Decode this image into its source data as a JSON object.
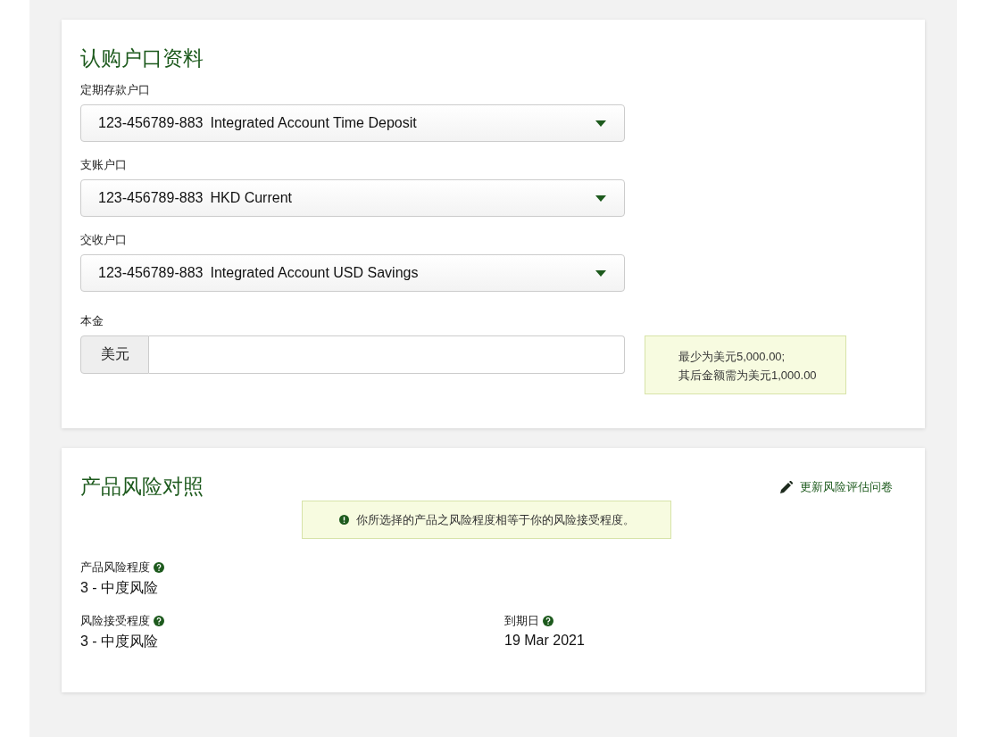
{
  "subscription": {
    "title": "认购户口资料",
    "selects": [
      {
        "label": "定期存款户口",
        "account": "123-456789-883",
        "name": "Integrated Account Time Deposit"
      },
      {
        "label": "支账户口",
        "account": "123-456789-883",
        "name": "HKD Current"
      },
      {
        "label": "交收户口",
        "account": "123-456789-883",
        "name": "Integrated Account USD Savings"
      }
    ],
    "amount": {
      "label": "本金",
      "currency": "美元",
      "hint": [
        "最少为美元5,000.00;",
        "其后金额需为美元1,000.00"
      ]
    }
  },
  "risk": {
    "title": "产品风险对照",
    "link": "更新风险评估问卷",
    "notice": "你所选择的产品之风险程度相等于你的风险接受程度。",
    "fields": [
      [
        {
          "label": "产品风险程度",
          "value": "3 - 中度风险"
        }
      ],
      [
        {
          "label": "风险接受程度",
          "value": "3 - 中度风险"
        },
        {
          "label": "到期日",
          "value": "19 Mar 2021"
        }
      ]
    ]
  }
}
